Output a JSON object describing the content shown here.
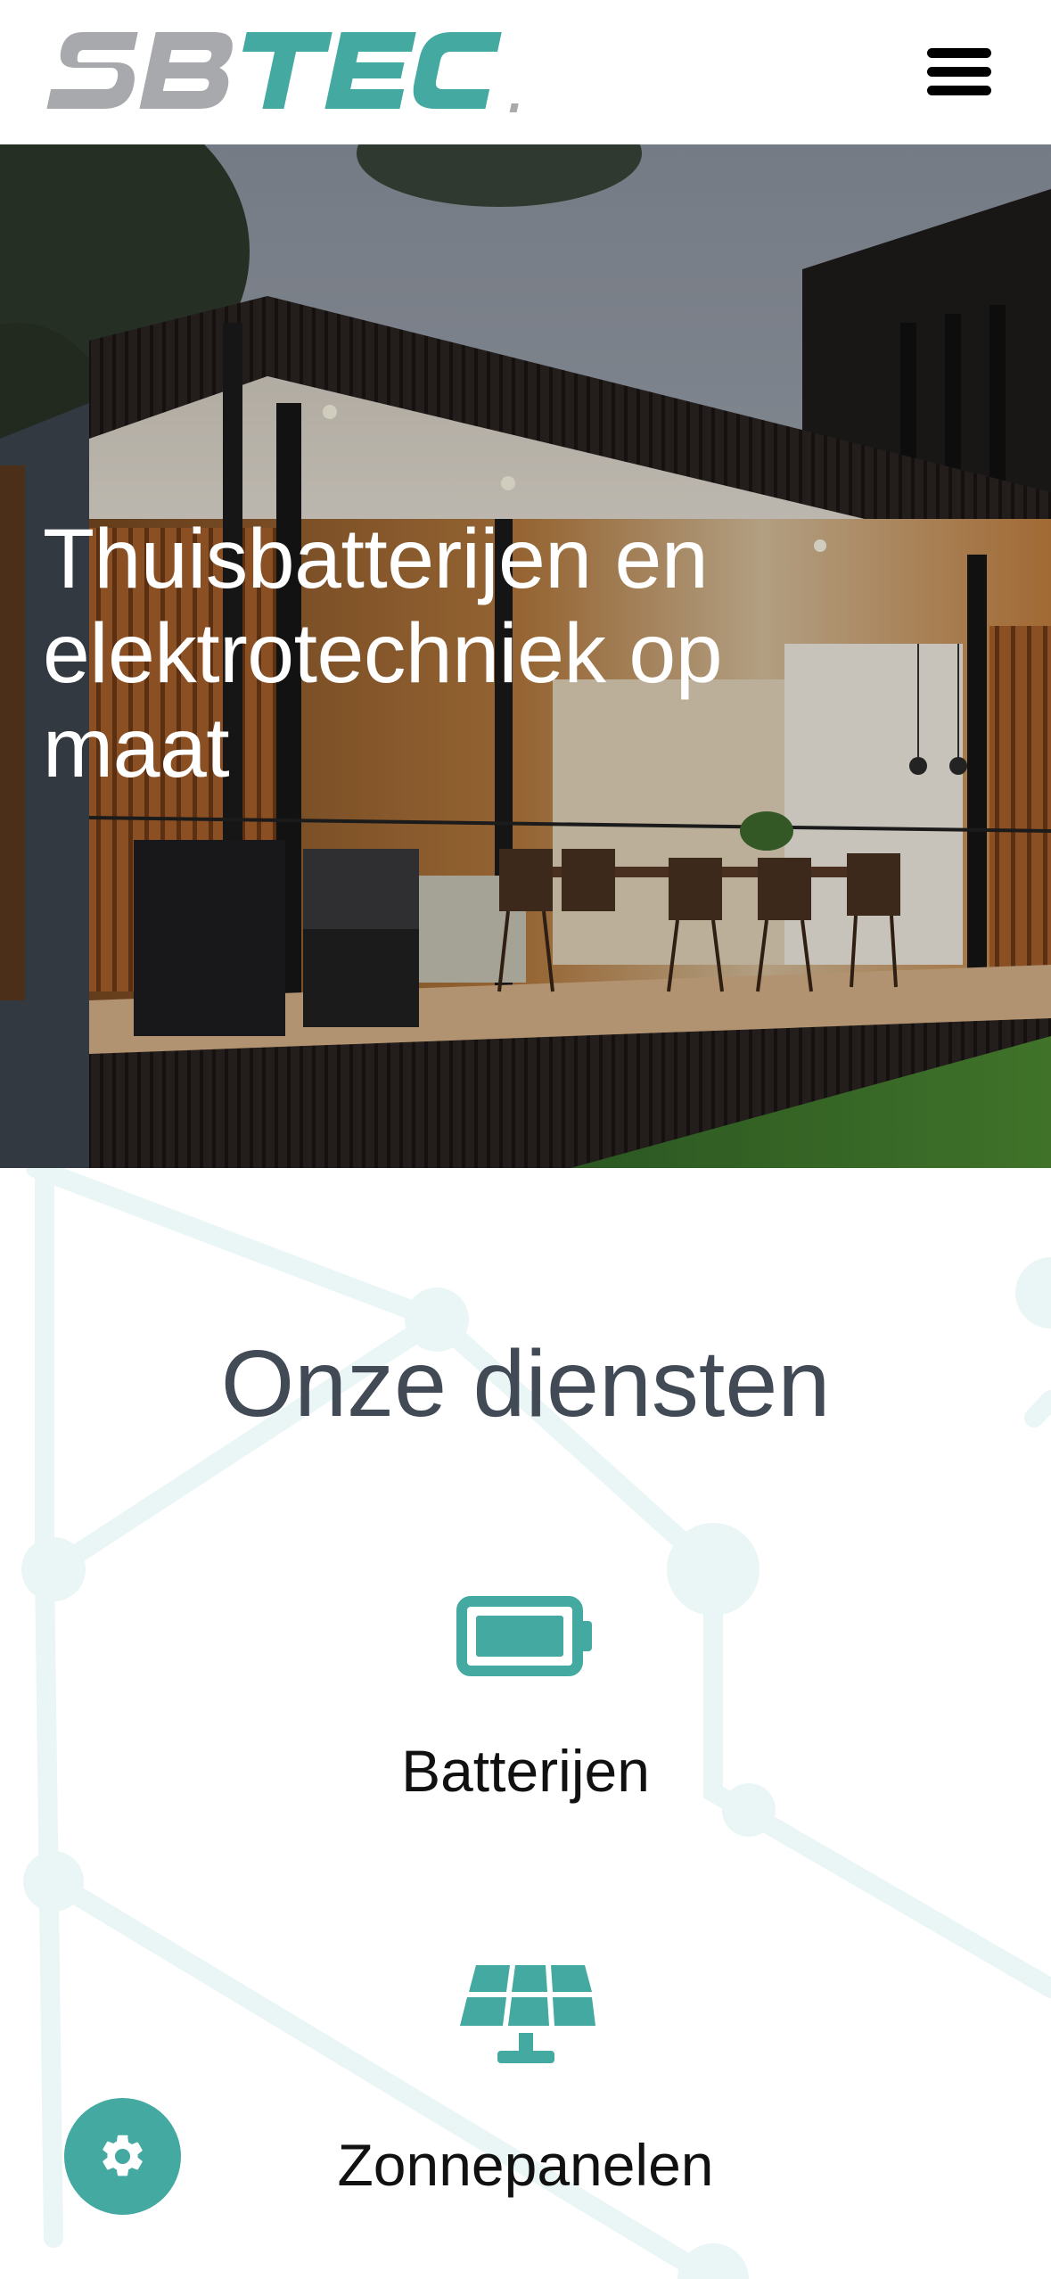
{
  "header": {
    "logo_text": "SBTEC.",
    "menu_icon": "hamburger-menu-icon"
  },
  "hero": {
    "title": "Thuisbatterijen en elektrotechniek op maat"
  },
  "services": {
    "title": "Onze diensten",
    "items": [
      {
        "label": "Batterijen",
        "icon": "battery-icon"
      },
      {
        "label": "Zonnepanelen",
        "icon": "solar-panel-icon"
      }
    ]
  },
  "settings_button": {
    "icon": "gear-icon"
  },
  "colors": {
    "accent": "#44a9a1",
    "logo_grey": "#a7a9ad",
    "heading_dark": "#414a55",
    "header_bg": "#ffffff"
  }
}
